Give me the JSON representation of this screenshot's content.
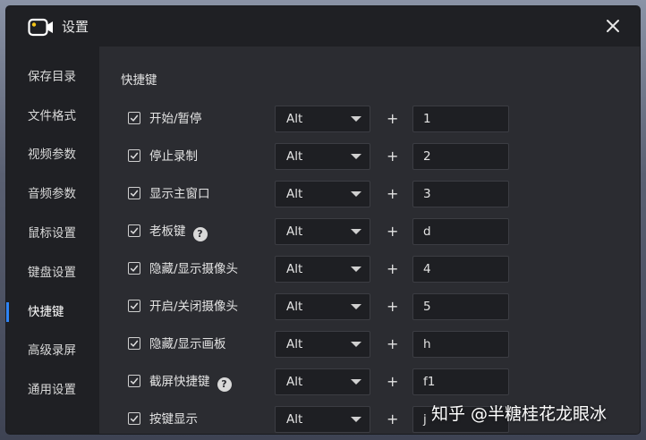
{
  "window": {
    "title": "设置"
  },
  "sidebar": {
    "items": [
      {
        "label": "保存目录"
      },
      {
        "label": "文件格式"
      },
      {
        "label": "视频参数"
      },
      {
        "label": "音频参数"
      },
      {
        "label": "鼠标设置"
      },
      {
        "label": "键盘设置"
      },
      {
        "label": "快捷键",
        "active": true
      },
      {
        "label": "高级录屏"
      },
      {
        "label": "通用设置"
      }
    ]
  },
  "section": {
    "title": "快捷键"
  },
  "hotkeys": [
    {
      "label": "开始/暂停",
      "checked": true,
      "modifier": "Alt",
      "key": "1",
      "help": false
    },
    {
      "label": "停止录制",
      "checked": true,
      "modifier": "Alt",
      "key": "2",
      "help": false
    },
    {
      "label": "显示主窗口",
      "checked": true,
      "modifier": "Alt",
      "key": "3",
      "help": false
    },
    {
      "label": "老板键",
      "checked": true,
      "modifier": "Alt",
      "key": "d",
      "help": true
    },
    {
      "label": "隐藏/显示摄像头",
      "checked": true,
      "modifier": "Alt",
      "key": "4",
      "help": false
    },
    {
      "label": "开启/关闭摄像头",
      "checked": true,
      "modifier": "Alt",
      "key": "5",
      "help": false
    },
    {
      "label": "隐藏/显示画板",
      "checked": true,
      "modifier": "Alt",
      "key": "h",
      "help": false
    },
    {
      "label": "截屏快捷键",
      "checked": true,
      "modifier": "Alt",
      "key": "f1",
      "help": true
    },
    {
      "label": "按键显示",
      "checked": true,
      "modifier": "Alt",
      "key": "j",
      "help": false
    }
  ],
  "plus_sign": "+",
  "help_glyph": "?",
  "watermark": "知乎 @半糖桂花龙眼冰",
  "colors": {
    "accent": "#2f84f5",
    "panel": "#2b2c31",
    "sidebar": "#1f2024",
    "field": "#1e1f23"
  },
  "icons": {
    "app": "camera-icon",
    "close": "close-icon",
    "check": "checkmark-icon",
    "dropdown": "chevron-down-icon",
    "help": "question-icon"
  }
}
